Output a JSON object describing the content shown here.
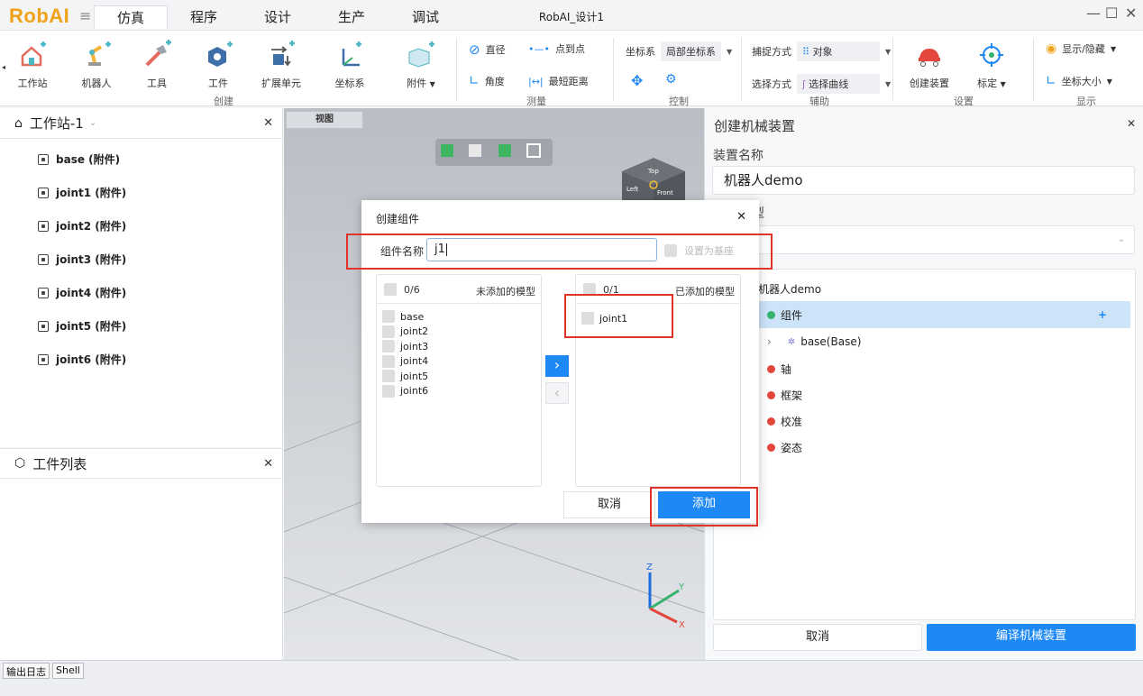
{
  "app": {
    "logo": "RobAI",
    "window_title": "RobAI_设计1",
    "menu_tabs": [
      "仿真",
      "程序",
      "设计",
      "生产",
      "调试"
    ]
  },
  "ribbon": {
    "create": {
      "items": [
        "工作站",
        "机器人",
        "工具",
        "工件",
        "扩展单元",
        "坐标系",
        "附件"
      ],
      "group": "创建"
    },
    "measure": {
      "diameter": "直径",
      "point_to_point": "点到点",
      "angle": "角度",
      "min_distance": "最短距离",
      "group": "测量"
    },
    "control": {
      "coord_label": "坐标系",
      "coord_value": "局部坐标系",
      "group": "控制"
    },
    "assist": {
      "capture_label": "捕捉方式",
      "capture_value": "对象",
      "select_label": "选择方式",
      "select_value": "选择曲线",
      "group": "辅助"
    },
    "settings": {
      "create_device": "创建装置",
      "calibrate": "标定",
      "group": "设置"
    },
    "display": {
      "show_hide": "显示/隐藏",
      "coord_size": "坐标大小",
      "group": "显示"
    }
  },
  "station_panel": {
    "title": "工作站-1",
    "items": [
      "base (附件)",
      "joint1 (附件)",
      "joint2 (附件)",
      "joint3 (附件)",
      "joint4 (附件)",
      "joint5 (附件)",
      "joint6 (附件)"
    ]
  },
  "workpiece_panel": {
    "title": "工件列表"
  },
  "viewport": {
    "tab": "视图",
    "cube_labels": [
      "Top",
      "Left",
      "Front"
    ],
    "axes": [
      "Z",
      "Y",
      "X"
    ]
  },
  "right_panel": {
    "title": "创建机械装置",
    "name_label": "装置名称",
    "name_value": "机器人demo",
    "type_label": "型",
    "tree": {
      "root": "机器人demo",
      "component": "组件",
      "base": "base(Base)",
      "axis": "轴",
      "frame": "框架",
      "calibration": "校准",
      "pose": "姿态"
    },
    "cancel": "取消",
    "compile": "编译机械装置"
  },
  "dialog": {
    "title": "创建组件",
    "name_label": "组件名称",
    "name_value": "j1",
    "set_base": "设置为基座",
    "left_count": "0/6",
    "left_title": "未添加的模型",
    "left_items": [
      "base",
      "joint2",
      "joint3",
      "joint4",
      "joint5",
      "joint6"
    ],
    "right_count": "0/1",
    "right_title": "已添加的模型",
    "right_items": [
      "joint1"
    ],
    "cancel": "取消",
    "add": "添加"
  },
  "status": {
    "tabs": [
      "输出日志",
      "Shell"
    ]
  },
  "colors": {
    "accent": "#1e88f5",
    "highlight": "#e0342a",
    "logo": "#f0a21a",
    "selected_row": "#cce3f8",
    "green": "#35b26b",
    "red": "#e2463d"
  }
}
